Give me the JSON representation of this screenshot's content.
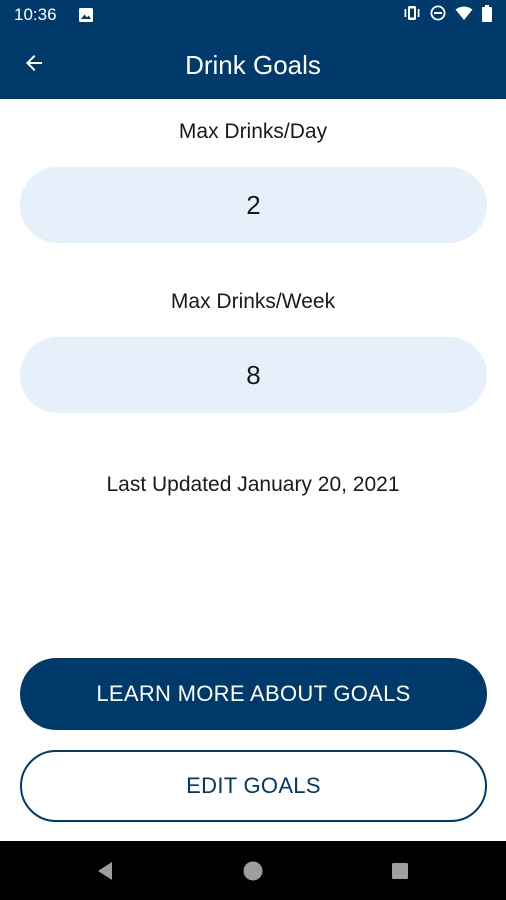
{
  "status_bar": {
    "time": "10:36",
    "icons": [
      "gallery-icon",
      "vibrate-icon",
      "do-not-disturb-icon",
      "wifi-icon",
      "battery-icon"
    ]
  },
  "app_bar": {
    "title": "Drink Goals",
    "back_icon": "arrow-left-icon"
  },
  "goals": {
    "daily_label": "Max Drinks/Day",
    "daily_value": "2",
    "weekly_label": "Max Drinks/Week",
    "weekly_value": "8",
    "last_updated": "Last Updated January 20, 2021"
  },
  "actions": {
    "learn_more_label": "LEARN MORE ABOUT GOALS",
    "edit_label": "EDIT GOALS"
  },
  "nav_bar": {
    "icons": [
      "back-triangle-icon",
      "home-circle-icon",
      "recents-square-icon"
    ]
  },
  "colors": {
    "primary": "#003a6b",
    "field_bg": "#e6f0fb",
    "nav_bg": "#000000"
  }
}
